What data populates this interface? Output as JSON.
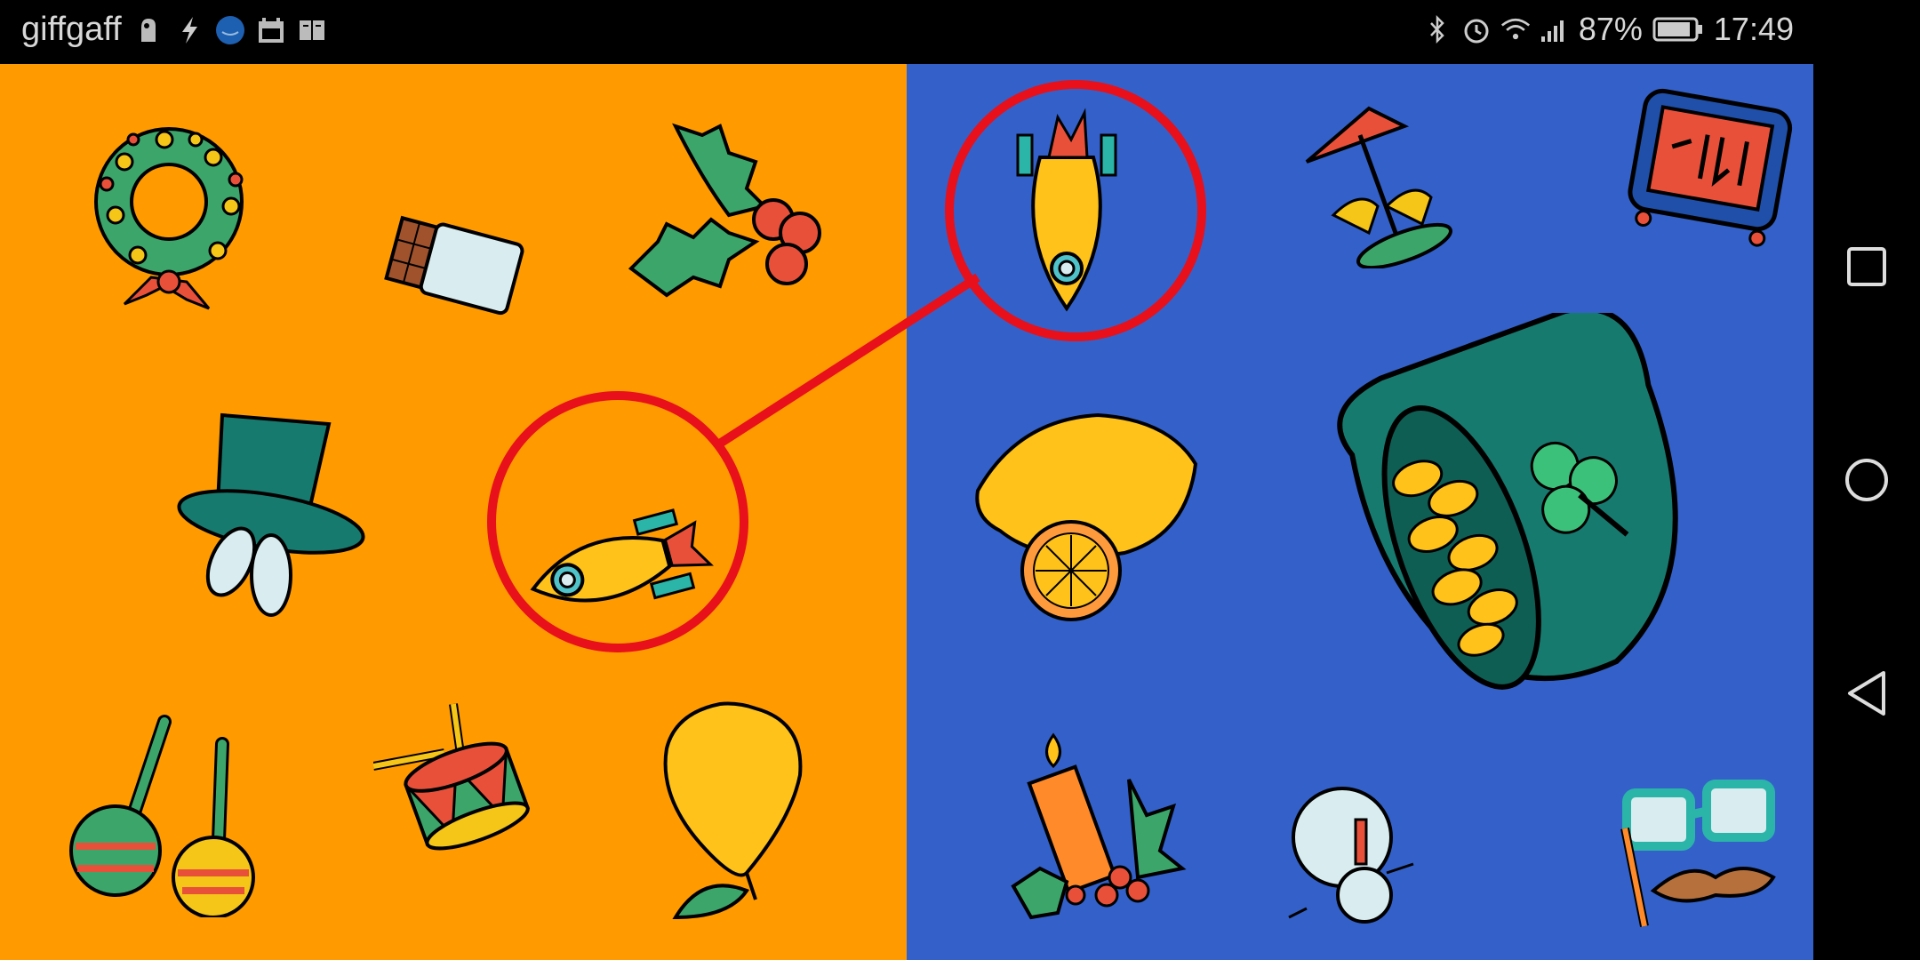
{
  "status_bar": {
    "carrier": "giffgaff",
    "battery_percent": "87%",
    "time": "17:49",
    "left_icons": [
      "notification-app-icon",
      "lightning-icon",
      "amazon-music-icon",
      "calendar-icon",
      "book-icon"
    ],
    "right_icons": [
      "bluetooth-icon",
      "alarm-icon",
      "wifi-icon",
      "signal-icon",
      "battery-icon"
    ]
  },
  "game": {
    "left_panel_color": "#FF9A00",
    "right_panel_color": "#3361C9",
    "highlight_color": "#E8101A",
    "left_items": [
      "wreath",
      "chocolate-bar",
      "holly",
      "top-hat",
      "rocket",
      "maracas",
      "drum",
      "pear"
    ],
    "right_items": [
      "rocket",
      "carousel",
      "ticket-display",
      "lemon",
      "pot-of-gold",
      "candle-holly",
      "snowman",
      "party-glasses"
    ],
    "matched_item": "rocket"
  },
  "nav_bar": {
    "buttons": [
      "recents-button",
      "home-button",
      "back-button"
    ]
  }
}
